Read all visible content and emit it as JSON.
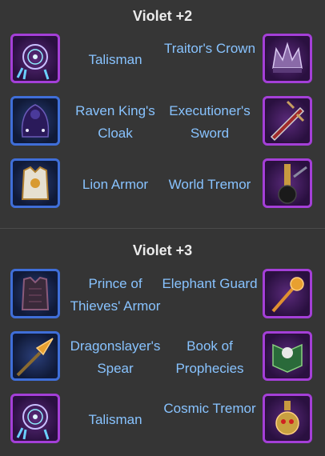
{
  "sections": [
    {
      "title": "Violet +2",
      "rows": [
        {
          "left": {
            "name": "Talisman",
            "icon": "talisman-icon"
          },
          "right": {
            "name": "Traitor's Crown",
            "icon": "crown-icon"
          }
        },
        {
          "left": {
            "name": "Raven King's Cloak",
            "icon": "cloak-icon"
          },
          "right": {
            "name": "Executioner's Sword",
            "icon": "sword-icon"
          }
        },
        {
          "left": {
            "name": "Lion Armor",
            "icon": "armor-icon"
          },
          "right": {
            "name": "World Tremor",
            "icon": "mace-icon"
          }
        }
      ]
    },
    {
      "title": "Violet +3",
      "rows": [
        {
          "left": {
            "name": "Prince of Thieves' Armor",
            "icon": "leather-armor-icon"
          },
          "right": {
            "name": "Elephant Guard",
            "icon": "scepter-icon"
          }
        },
        {
          "left": {
            "name": "Dragonslayer's Spear",
            "icon": "spear-icon"
          },
          "right": {
            "name": "Book of Prophecies",
            "icon": "book-icon"
          }
        },
        {
          "left": {
            "name": "Talisman",
            "icon": "talisman-icon"
          },
          "right": {
            "name": "Cosmic Tremor",
            "icon": "skull-flask-icon"
          }
        }
      ]
    }
  ],
  "colors": {
    "background": "#353535",
    "label": "#88c3ff",
    "title": "#ececec",
    "purple_frame": "#a43fd8",
    "blue_frame": "#3f6ed8"
  }
}
